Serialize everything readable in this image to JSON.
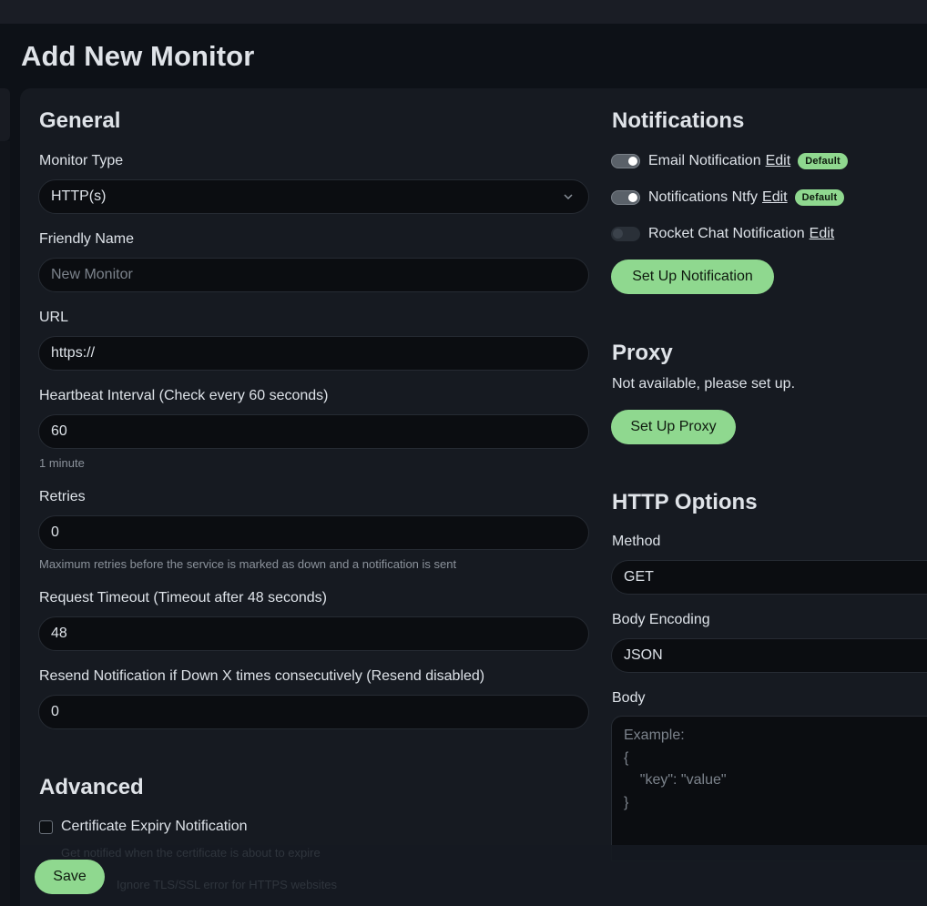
{
  "page": {
    "title": "Add New Monitor"
  },
  "general": {
    "title": "General",
    "monitor_type": {
      "label": "Monitor Type",
      "value": "HTTP(s)"
    },
    "friendly_name": {
      "label": "Friendly Name",
      "placeholder": "New Monitor"
    },
    "url": {
      "label": "URL",
      "value": "https://"
    },
    "heartbeat": {
      "label": "Heartbeat Interval (Check every 60 seconds)",
      "value": "60",
      "hint": "1 minute"
    },
    "retries": {
      "label": "Retries",
      "value": "0",
      "hint": "Maximum retries before the service is marked as down and a notification is sent"
    },
    "timeout": {
      "label": "Request Timeout (Timeout after 48 seconds)",
      "value": "48"
    },
    "resend": {
      "label": "Resend Notification if Down X times consecutively (Resend disabled)",
      "value": "0"
    }
  },
  "advanced": {
    "title": "Advanced",
    "cert_expiry_label": "Certificate Expiry Notification",
    "cert_expiry_checked": false,
    "hidden_hint_1": "Get notified when the certificate is about to expire",
    "hidden_hint_2": "Ignore TLS/SSL error for HTTPS websites"
  },
  "notifications": {
    "title": "Notifications",
    "items": [
      {
        "name": "Email Notification",
        "edit": "Edit",
        "badge": "Default",
        "enabled": true
      },
      {
        "name": "Notifications Ntfy",
        "edit": "Edit",
        "badge": "Default",
        "enabled": true
      },
      {
        "name": "Rocket Chat Notification",
        "edit": "Edit",
        "badge": "",
        "enabled": false
      }
    ],
    "setup_button": "Set Up Notification"
  },
  "proxy": {
    "title": "Proxy",
    "status": "Not available, please set up.",
    "setup_button": "Set Up Proxy"
  },
  "http_options": {
    "title": "HTTP Options",
    "method": {
      "label": "Method",
      "value": "GET"
    },
    "body_encoding": {
      "label": "Body Encoding",
      "value": "JSON"
    },
    "body": {
      "label": "Body",
      "placeholder": "Example:\n{\n    \"key\": \"value\"\n}"
    }
  },
  "footer": {
    "save_label": "Save"
  },
  "icons": {
    "select_caret": "chevron-down-icon"
  },
  "colors": {
    "accent": "#8fd88f",
    "background": "#0d1117",
    "card": "#161a21",
    "input": "#0b0d11"
  }
}
